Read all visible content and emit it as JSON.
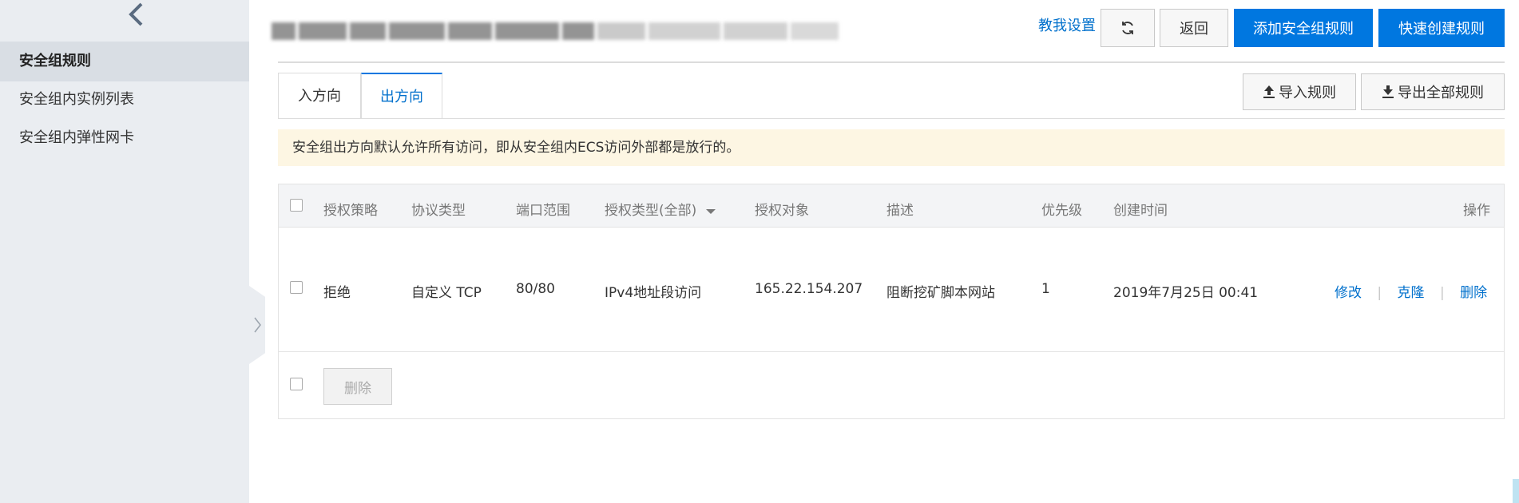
{
  "sidebar": {
    "items": [
      {
        "label": "安全组规则",
        "active": true
      },
      {
        "label": "安全组内实例列表",
        "active": false
      },
      {
        "label": "安全组内弹性网卡",
        "active": false
      }
    ]
  },
  "header": {
    "help_link": "教我设置",
    "back_label": "返回",
    "add_rule_label": "添加安全组规则",
    "quick_create_label": "快速创建规则"
  },
  "tabs": [
    {
      "label": "入方向",
      "active": false
    },
    {
      "label": "出方向",
      "active": true
    }
  ],
  "import_label": "导入规则",
  "export_label": "导出全部规则",
  "notice": "安全组出方向默认允许所有访问，即从安全组内ECS访问外部都是放行的。",
  "table": {
    "columns": [
      "授权策略",
      "协议类型",
      "端口范围",
      "授权类型(全部)",
      "授权对象",
      "描述",
      "优先级",
      "创建时间",
      "操作"
    ],
    "rows": [
      {
        "policy": "拒绝",
        "protocol": "自定义 TCP",
        "port": "80/80",
        "auth_type": "IPv4地址段访问",
        "target": "165.22.154.207",
        "description": "阻断挖矿脚本网站",
        "priority": "1",
        "created": "2019年7月25日 00:41",
        "ops": [
          "修改",
          "克隆",
          "删除"
        ]
      }
    ],
    "bulk_delete_label": "删除"
  },
  "colors": {
    "primary": "#0077e0",
    "link": "#0070cc",
    "notice_bg": "#fdf6e3",
    "sidebar_bg": "#eaedf1"
  }
}
